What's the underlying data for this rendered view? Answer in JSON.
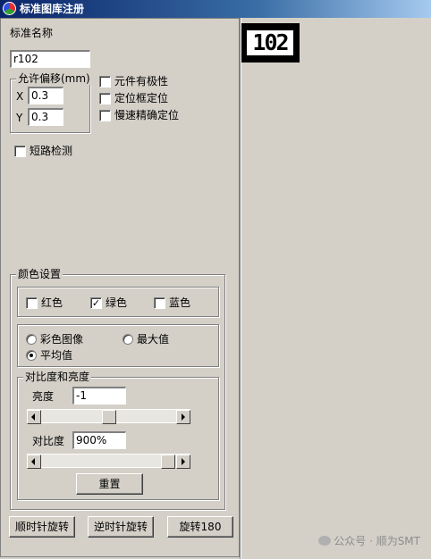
{
  "window": {
    "title": "标准图库注册"
  },
  "standard_name": {
    "label": "标准名称",
    "value": "r102"
  },
  "offset": {
    "caption": "允许偏移(mm)",
    "x_label": "X",
    "x_value": "0.3",
    "y_label": "Y",
    "y_value": "0.3"
  },
  "options": [
    {
      "label": "元件有极性",
      "checked": false
    },
    {
      "label": "定位框定位",
      "checked": false
    },
    {
      "label": "慢速精确定位",
      "checked": false
    }
  ],
  "short_circuit": {
    "label": "短路检测",
    "checked": false
  },
  "color_settings": {
    "caption": "颜色设置",
    "channels": [
      {
        "label": "红色",
        "checked": false
      },
      {
        "label": "绿色",
        "checked": true
      },
      {
        "label": "蓝色",
        "checked": false
      }
    ],
    "modes": [
      {
        "label": "彩色图像",
        "selected": false
      },
      {
        "label": "最大值",
        "selected": false
      },
      {
        "label": "平均值",
        "selected": true
      }
    ],
    "contrast_brightness": {
      "caption": "对比度和亮度",
      "brightness_label": "亮度",
      "brightness_value": "-1",
      "brightness_slider": 0.5,
      "contrast_label": "对比度",
      "contrast_value": "900%",
      "contrast_slider": 1.0,
      "reset_label": "重置"
    }
  },
  "buttons": {
    "rotate_cw": "顺时针旋转",
    "rotate_ccw": "逆时针旋转",
    "rotate_180": "旋转180"
  },
  "preview": {
    "part_text": "102"
  },
  "watermark": {
    "text": "公众号 · 顺为SMT"
  }
}
